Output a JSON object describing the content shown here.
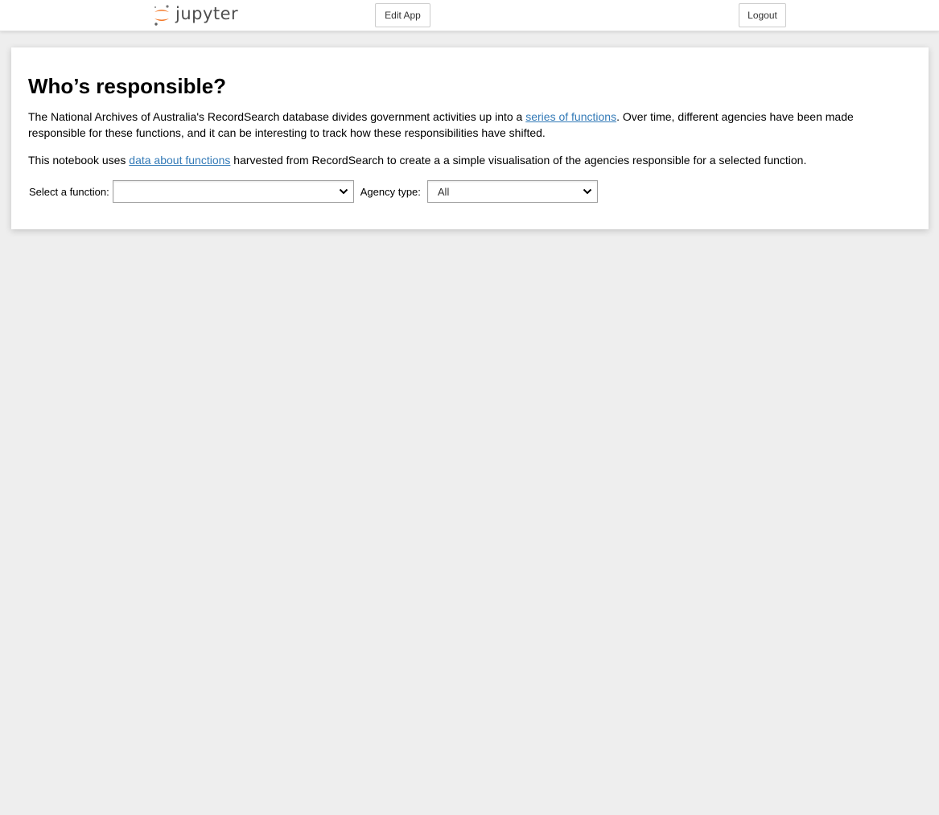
{
  "header": {
    "logo_text": "jupyter",
    "edit_label": "Edit App",
    "logout_label": "Logout"
  },
  "main": {
    "title": "Who’s responsible?",
    "p1_before": "The National Archives of Australia's RecordSearch database divides government activities up into a ",
    "p1_link": "series of functions",
    "p1_after": ". Over time, different agencies have been made responsible for these functions, and it can be interesting to track how these responsibilities have shifted.",
    "p2_before": "This notebook uses ",
    "p2_link": "data about functions",
    "p2_after": " harvested from RecordSearch to create a a simple visualisation of the agencies responsible for a selected function."
  },
  "widgets": {
    "function_label": "Select a function:",
    "function_value": "",
    "agency_label": "Agency type:",
    "agency_value": "All"
  },
  "colors": {
    "link": "#337ab7",
    "logo_orange": "#f37726",
    "background": "#eeeeee"
  }
}
